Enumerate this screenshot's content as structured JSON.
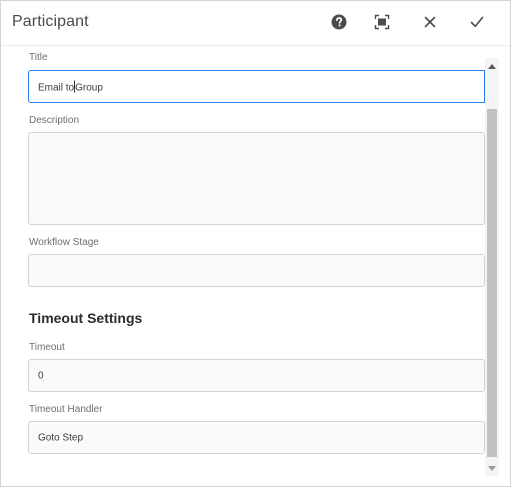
{
  "dialog": {
    "title": "Participant",
    "actions": [
      {
        "name": "help",
        "icon": "help-icon"
      },
      {
        "name": "fullscreen",
        "icon": "fullscreen-icon"
      },
      {
        "name": "close",
        "icon": "close-icon"
      },
      {
        "name": "done",
        "icon": "checkmark-icon"
      }
    ]
  },
  "form": {
    "title_label": "Title",
    "title_value_before_cursor": "Email to",
    "title_value_after_cursor": "Group",
    "description_label": "Description",
    "description_value": "",
    "workflow_stage_label": "Workflow Stage",
    "workflow_stage_value": "",
    "timeout_section_heading": "Timeout Settings",
    "timeout_label": "Timeout",
    "timeout_value": "0",
    "timeout_handler_label": "Timeout Handler",
    "timeout_handler_value": "Goto Step"
  },
  "colors": {
    "accent": "#2680eb",
    "border": "#d3d3d3",
    "scroll_thumb": "#c1c1c1"
  }
}
